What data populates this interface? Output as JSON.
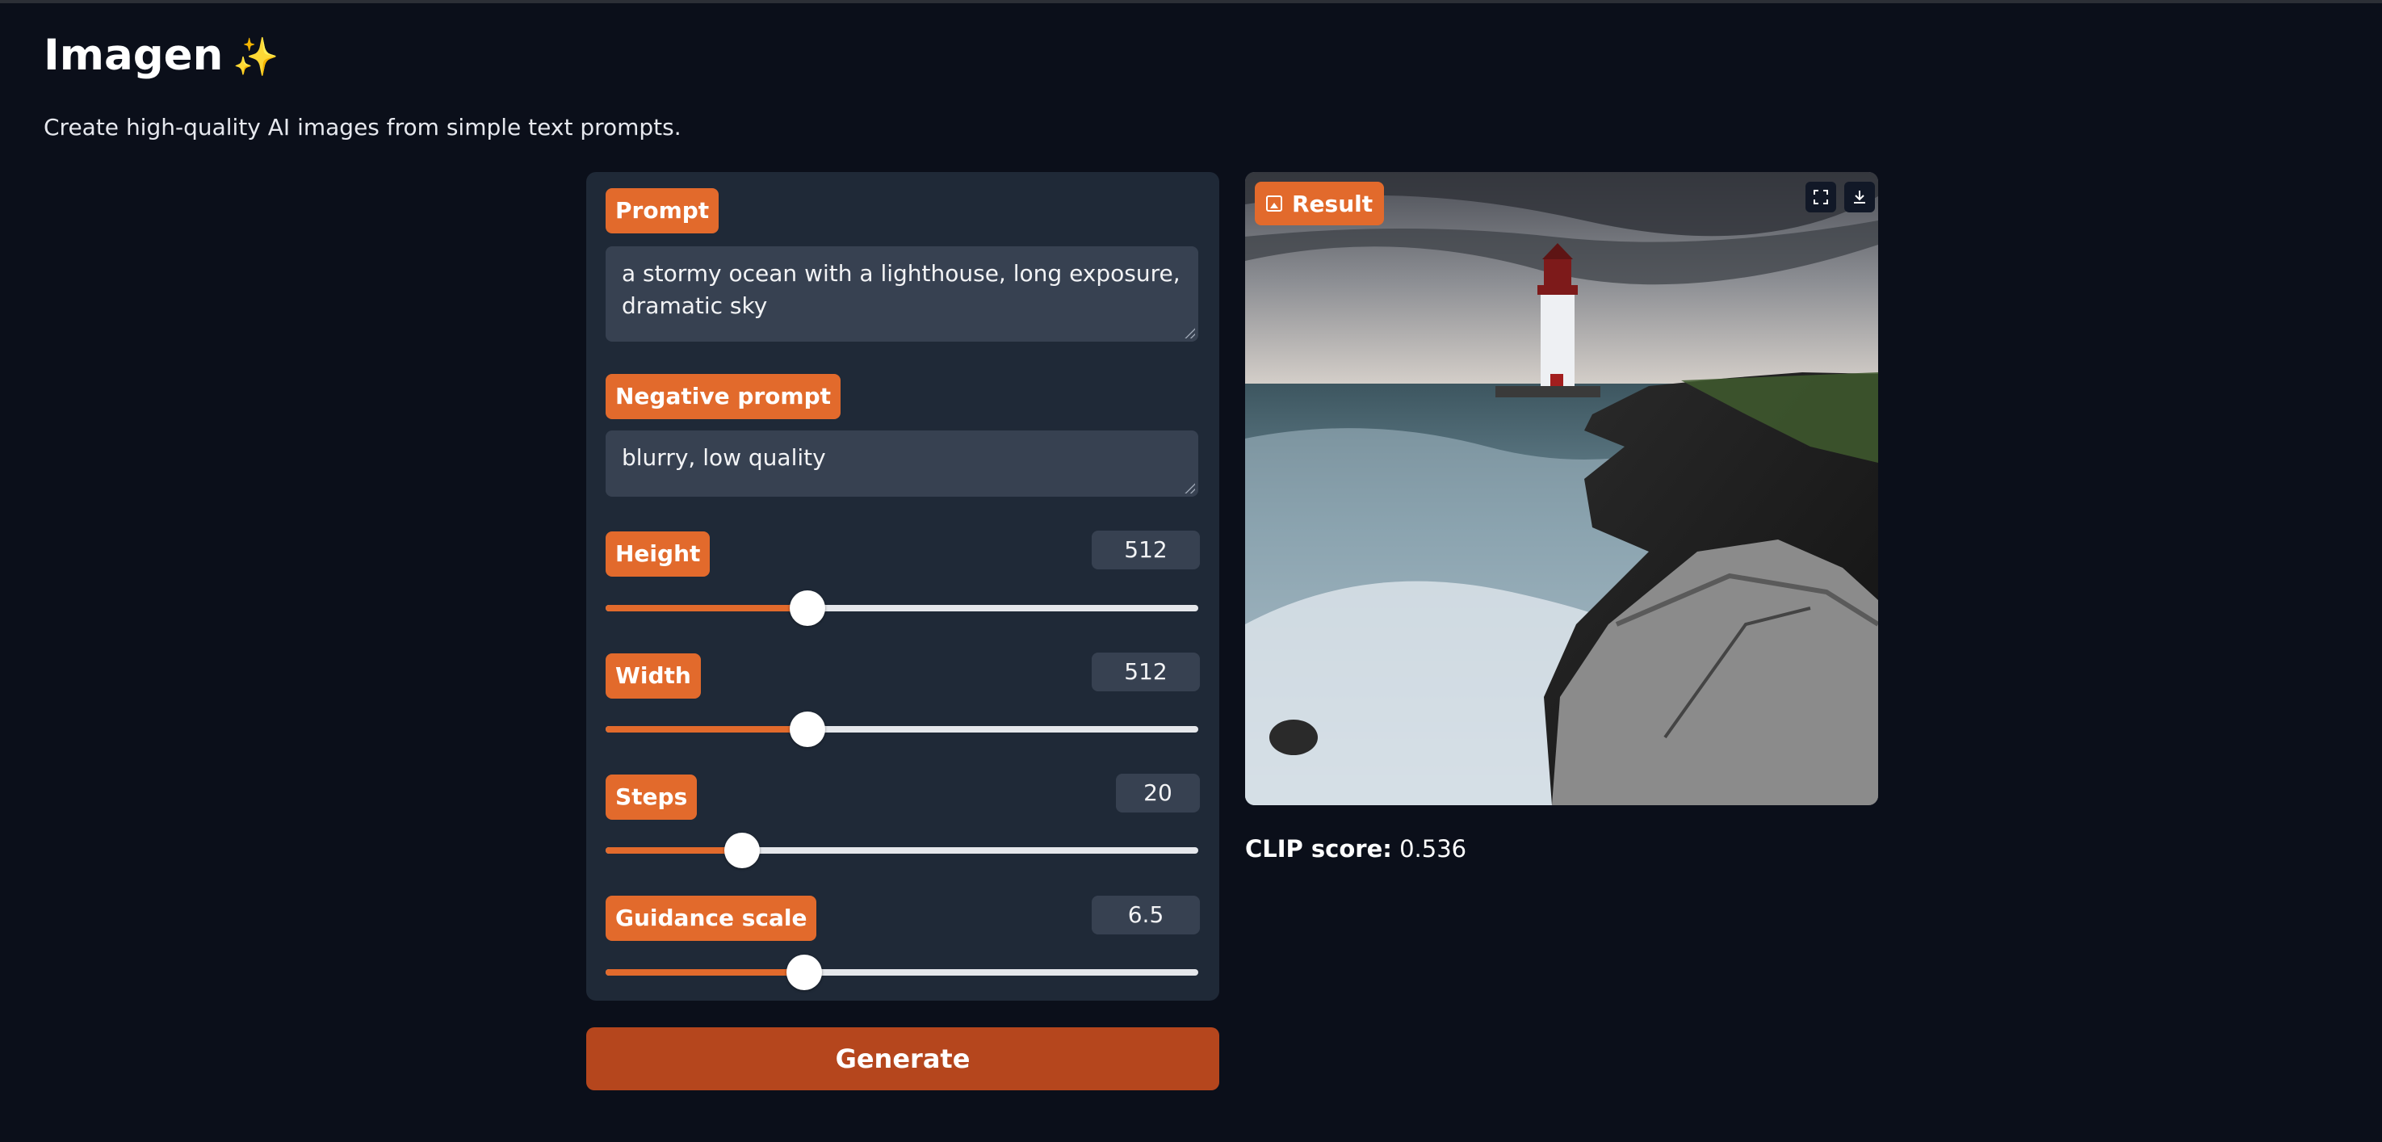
{
  "app": {
    "title": "Imagen",
    "title_emoji": "✨",
    "subtitle": "Create high-quality AI images from simple text prompts."
  },
  "form": {
    "prompt": {
      "label": "Prompt",
      "value": "a stormy ocean with a lighthouse, long exposure, dramatic sky"
    },
    "negative_prompt": {
      "label": "Negative prompt",
      "value": "blurry, low quality"
    },
    "height": {
      "label": "Height",
      "value": "512",
      "fraction": 0.34
    },
    "width": {
      "label": "Width",
      "value": "512",
      "fraction": 0.34
    },
    "steps": {
      "label": "Steps",
      "value": "20",
      "fraction": 0.23
    },
    "guidance_scale": {
      "label": "Guidance scale",
      "value": "6.5",
      "fraction": 0.335
    },
    "generate_label": "Generate"
  },
  "result": {
    "label": "Result",
    "image_icon": "image-icon",
    "fullscreen_icon": "fullscreen-icon",
    "download_icon": "download-icon",
    "clip_label": "CLIP score:",
    "clip_value": "0.536"
  },
  "colors": {
    "background": "#0b0f1a",
    "panel": "#1f2937",
    "input": "#374151",
    "accent": "#e26a2c",
    "button": "#b5461d"
  }
}
